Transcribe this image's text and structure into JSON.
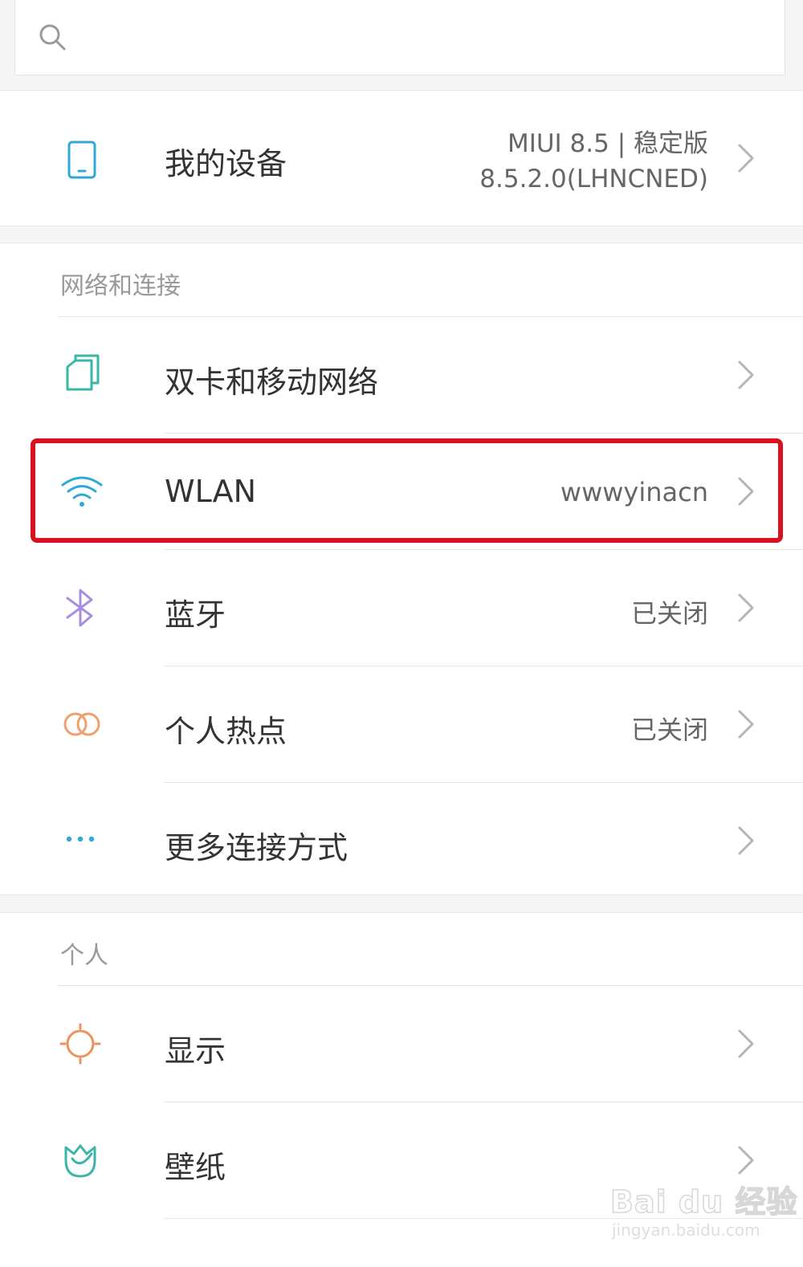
{
  "search": {
    "placeholder": ""
  },
  "device": {
    "label": "我的设备",
    "version_line1": "MIUI 8.5 | 稳定版",
    "version_line2": "8.5.2.0(LHNCNED)",
    "icon": "phone-icon"
  },
  "sections": {
    "network": {
      "title": "网络和连接",
      "items": [
        {
          "label": "双卡和移动网络",
          "value": "",
          "icon": "dual-sim-icon",
          "icon_color": "#3ab5a8"
        },
        {
          "label": "WLAN",
          "value": "wwwyinacn",
          "icon": "wifi-icon",
          "icon_color": "#2fa9d8"
        },
        {
          "label": "蓝牙",
          "value": "已关闭",
          "icon": "bluetooth-icon",
          "icon_color": "#a88ee0"
        },
        {
          "label": "个人热点",
          "value": "已关闭",
          "icon": "hotspot-icon",
          "icon_color": "#f0a070"
        },
        {
          "label": "更多连接方式",
          "value": "",
          "icon": "more-dots-icon",
          "icon_color": "#2fa9d8"
        }
      ]
    },
    "personal": {
      "title": "个人",
      "items": [
        {
          "label": "显示",
          "value": "",
          "icon": "display-sun-icon",
          "icon_color": "#f0915a"
        },
        {
          "label": "壁纸",
          "value": "",
          "icon": "wallpaper-tulip-icon",
          "icon_color": "#3ab5a8"
        }
      ]
    }
  },
  "watermark": {
    "main": "Bai du 经验",
    "sub": "jingyan.baidu.com"
  },
  "colors": {
    "highlight": "#d8101f",
    "accent_teal": "#3ab5a8",
    "accent_blue": "#2fa9d8"
  }
}
